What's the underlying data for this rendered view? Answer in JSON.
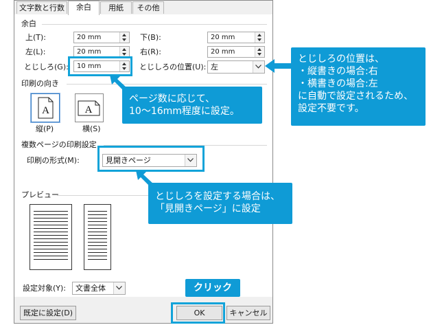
{
  "tabs": [
    {
      "label": "文字数と行数",
      "active": false
    },
    {
      "label": "余白",
      "active": true
    },
    {
      "label": "用紙",
      "active": false
    },
    {
      "label": "その他",
      "active": false
    }
  ],
  "margins": {
    "section_label": "余白",
    "top_label": "上(T):",
    "top_value": "20 mm",
    "bottom_label": "下(B):",
    "bottom_value": "20 mm",
    "left_label": "左(L):",
    "left_value": "20 mm",
    "right_label": "右(R):",
    "right_value": "20 mm",
    "gutter_label": "とじしろ(G):",
    "gutter_value": "10 mm",
    "gutter_pos_label": "とじしろの位置(U):",
    "gutter_pos_value": "左"
  },
  "orientation": {
    "section_label": "印刷の向き",
    "portrait_label": "縦(P)",
    "landscape_label": "横(S)",
    "icon_letter": "A"
  },
  "multi": {
    "section_label": "複数ページの印刷設定",
    "format_label": "印刷の形式(M):",
    "format_value": "見開きページ"
  },
  "preview": {
    "section_label": "プレビュー"
  },
  "apply": {
    "label": "設定対象(Y):",
    "value": "文書全体"
  },
  "buttons": {
    "default": "既定に設定(D)",
    "ok": "OK",
    "cancel": "キャンセル"
  },
  "callouts": {
    "gutter_position": [
      "とじしろの位置は、",
      "・縦書きの場合:右",
      "・横書きの場合:左",
      "に自動で設定されるため、",
      "設定不要です。"
    ],
    "gutter_value": [
      "ページ数に応じて、",
      "10〜16mm程度に設定。"
    ],
    "format": [
      "とじしろを設定する場合は、",
      "「見開きページ」に設定"
    ],
    "click": "クリック"
  },
  "colors": {
    "accent": "#0f9bd6",
    "highlight": "#12a3d9"
  }
}
